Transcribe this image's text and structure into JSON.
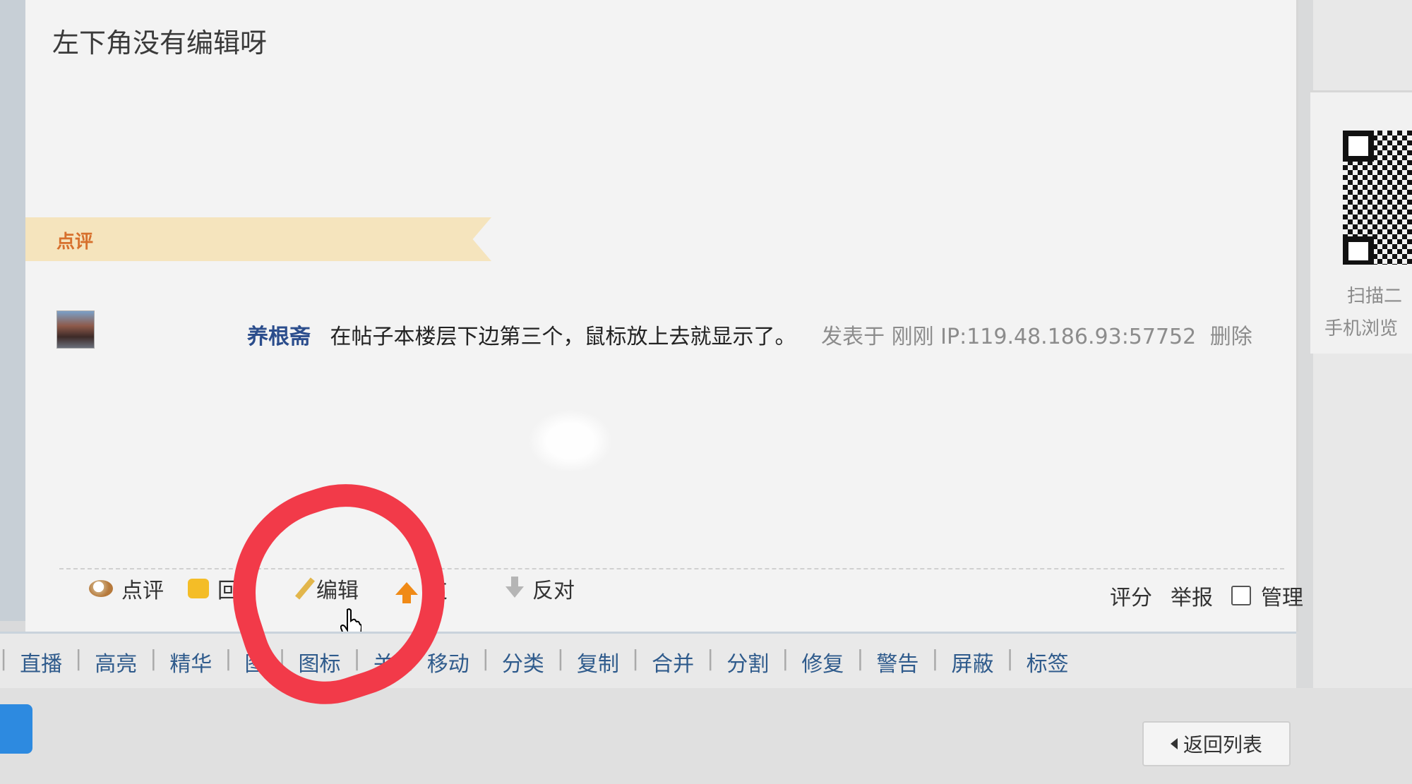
{
  "post": {
    "text": "左下角没有编辑呀"
  },
  "comments_section": {
    "label": "点评"
  },
  "comment": {
    "user": "养根斋",
    "text": "在帖子本楼层下边第三个，鼠标放上去就显示了。",
    "meta": "发表于 刚刚 IP:119.48.186.93:57752",
    "delete": "删除"
  },
  "actions": {
    "comment": "点评",
    "reply": "回",
    "edit": "编辑",
    "support": "支",
    "oppose": "反对",
    "rate": "评分",
    "report": "举报",
    "manage": "管理"
  },
  "mod_bar": {
    "items": [
      "直播",
      "高亮",
      "精华",
      "图",
      "图标",
      "关",
      "移动",
      "分类",
      "复制",
      "合并",
      "分割",
      "修复",
      "警告",
      "屏蔽",
      "标签"
    ]
  },
  "back_button": {
    "label": "返回列表"
  },
  "sidebar": {
    "scan_text": "扫描二",
    "mobile_text": "手机浏览"
  },
  "colors": {
    "accent_orange": "#f08a16",
    "link_blue": "#2f5b8c",
    "marker_red": "#f23a49"
  }
}
